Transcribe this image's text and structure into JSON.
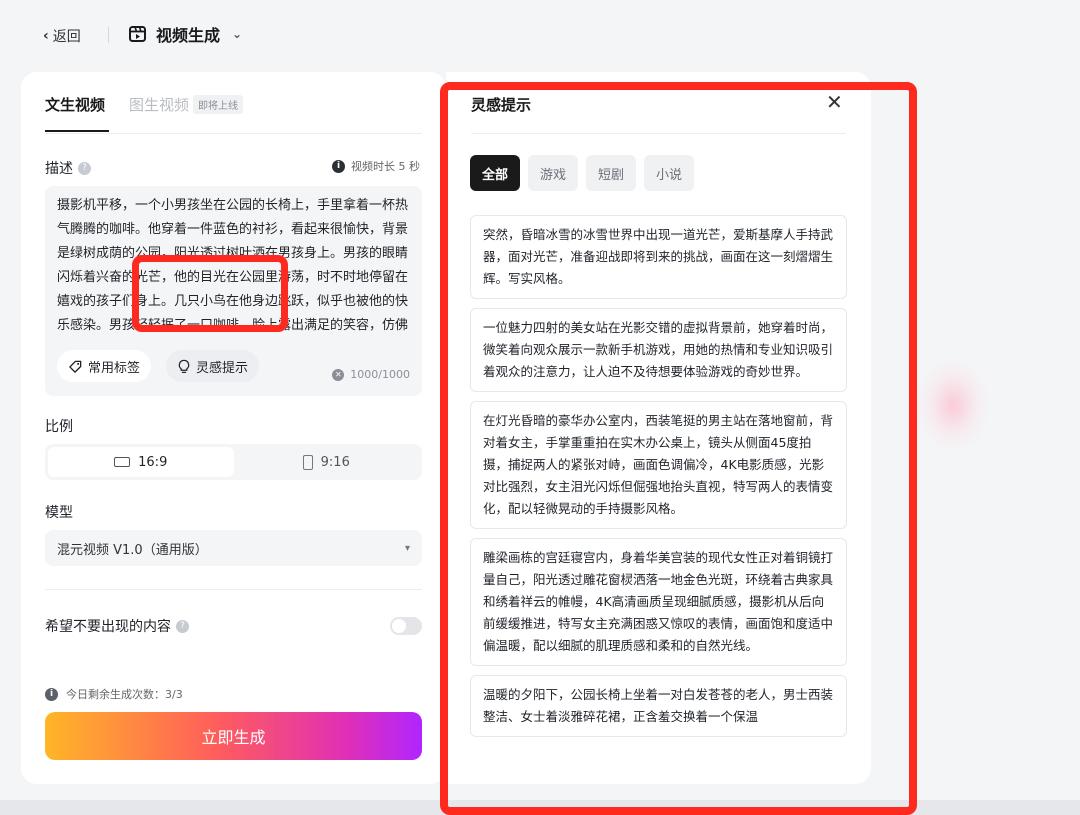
{
  "header": {
    "back_label": "返回",
    "app_title": "视频生成"
  },
  "left": {
    "tabs": [
      {
        "label": "文生视频"
      },
      {
        "label": "图生视频"
      }
    ],
    "soon_badge": "即将上线",
    "description_label": "描述",
    "duration": "视频时长 5 秒",
    "description_text": "摄影机平移，一个小男孩坐在公园的长椅上，手里拿着一杯热气腾腾的咖啡。他穿着一件蓝色的衬衫，看起来很愉快，背景是绿树成荫的公园，阳光透过树叶洒在男孩身上。男孩的眼睛闪烁着兴奋的光芒，他的目光在公园里游荡，时不时地停留在嬉戏的孩子们身上。几只小鸟在他身边跳跃，似乎也被他的快乐感染。男孩轻轻抿了一口咖啡，脸上露出满足的笑容，仿佛这杯咖啡不仅温暖了他的",
    "tags_button": "常用标签",
    "inspire_button": "灵感提示",
    "char_count": "1000/1000",
    "ratio_label": "比例",
    "ratios": [
      {
        "label": "16:9"
      },
      {
        "label": "9:16"
      }
    ],
    "model_label": "模型",
    "model_value": "混元视频 V1.0（通用版）",
    "negative_label": "希望不要出现的内容",
    "remaining": "今日剩余生成次数：3/3",
    "generate_button": "立即生成"
  },
  "right": {
    "title": "灵感提示",
    "filters": [
      {
        "label": "全部"
      },
      {
        "label": "游戏"
      },
      {
        "label": "短剧"
      },
      {
        "label": "小说"
      }
    ],
    "cards": [
      {
        "text": "突然，昏暗冰雪的冰雪世界中出现一道光芒，爱斯基摩人手持武器，面对光芒，准备迎战即将到来的挑战，画面在这一刻熠熠生辉。写实风格。"
      },
      {
        "text": "一位魅力四射的美女站在光影交错的虚拟背景前，她穿着时尚，微笑着向观众展示一款新手机游戏，用她的热情和专业知识吸引着观众的注意力，让人迫不及待想要体验游戏的奇妙世界。"
      },
      {
        "text": "在灯光昏暗的豪华办公室内，西装笔挺的男主站在落地窗前，背对着女主，手掌重重拍在实木办公桌上，镜头从侧面45度拍摄，捕捉两人的紧张对峙，画面色调偏冷，4K电影质感，光影对比强烈，女主泪光闪烁但倔强地抬头直视，特写两人的表情变化，配以轻微晃动的手持摄影风格。"
      },
      {
        "text": "雕梁画栋的宫廷寝宫内，身着华美宫装的现代女性正对着铜镜打量自己，阳光透过雕花窗棂洒落一地金色光斑，环绕着古典家具和绣着祥云的帷幔，4K高清画质呈现细腻质感，摄影机从后向前缓缓推进，特写女主充满困惑又惊叹的表情，画面饱和度适中偏温暖，配以细腻的肌理质感和柔和的自然光线。"
      },
      {
        "text": "温暖的夕阳下，公园长椅上坐着一对白发苍苍的老人，男士西装整洁、女士着淡雅碎花裙，正含羞交换着一个保温"
      }
    ]
  }
}
